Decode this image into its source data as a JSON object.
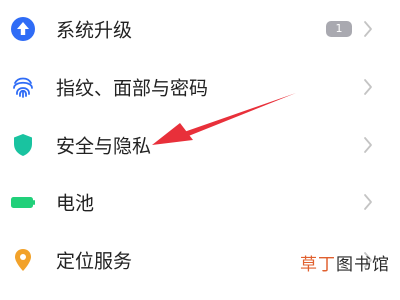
{
  "settings": {
    "items": [
      {
        "label": "系统升级",
        "icon": "upgrade-arrow-icon",
        "icon_color": "#2f6cf6",
        "badge": "1"
      },
      {
        "label": "指纹、面部与密码",
        "icon": "fingerprint-icon",
        "icon_color": "#2f6cf6"
      },
      {
        "label": "安全与隐私",
        "icon": "shield-icon",
        "icon_color": "#19c3a0"
      },
      {
        "label": "电池",
        "icon": "battery-icon",
        "icon_color": "#21d07a"
      },
      {
        "label": "定位服务",
        "icon": "location-pin-icon",
        "icon_color": "#f2a22a"
      }
    ]
  },
  "annotation": {
    "arrow_color": "#e8303a",
    "points_to": "安全与隐私"
  },
  "watermark": {
    "part1": "草丁",
    "part2": "图书馆"
  }
}
